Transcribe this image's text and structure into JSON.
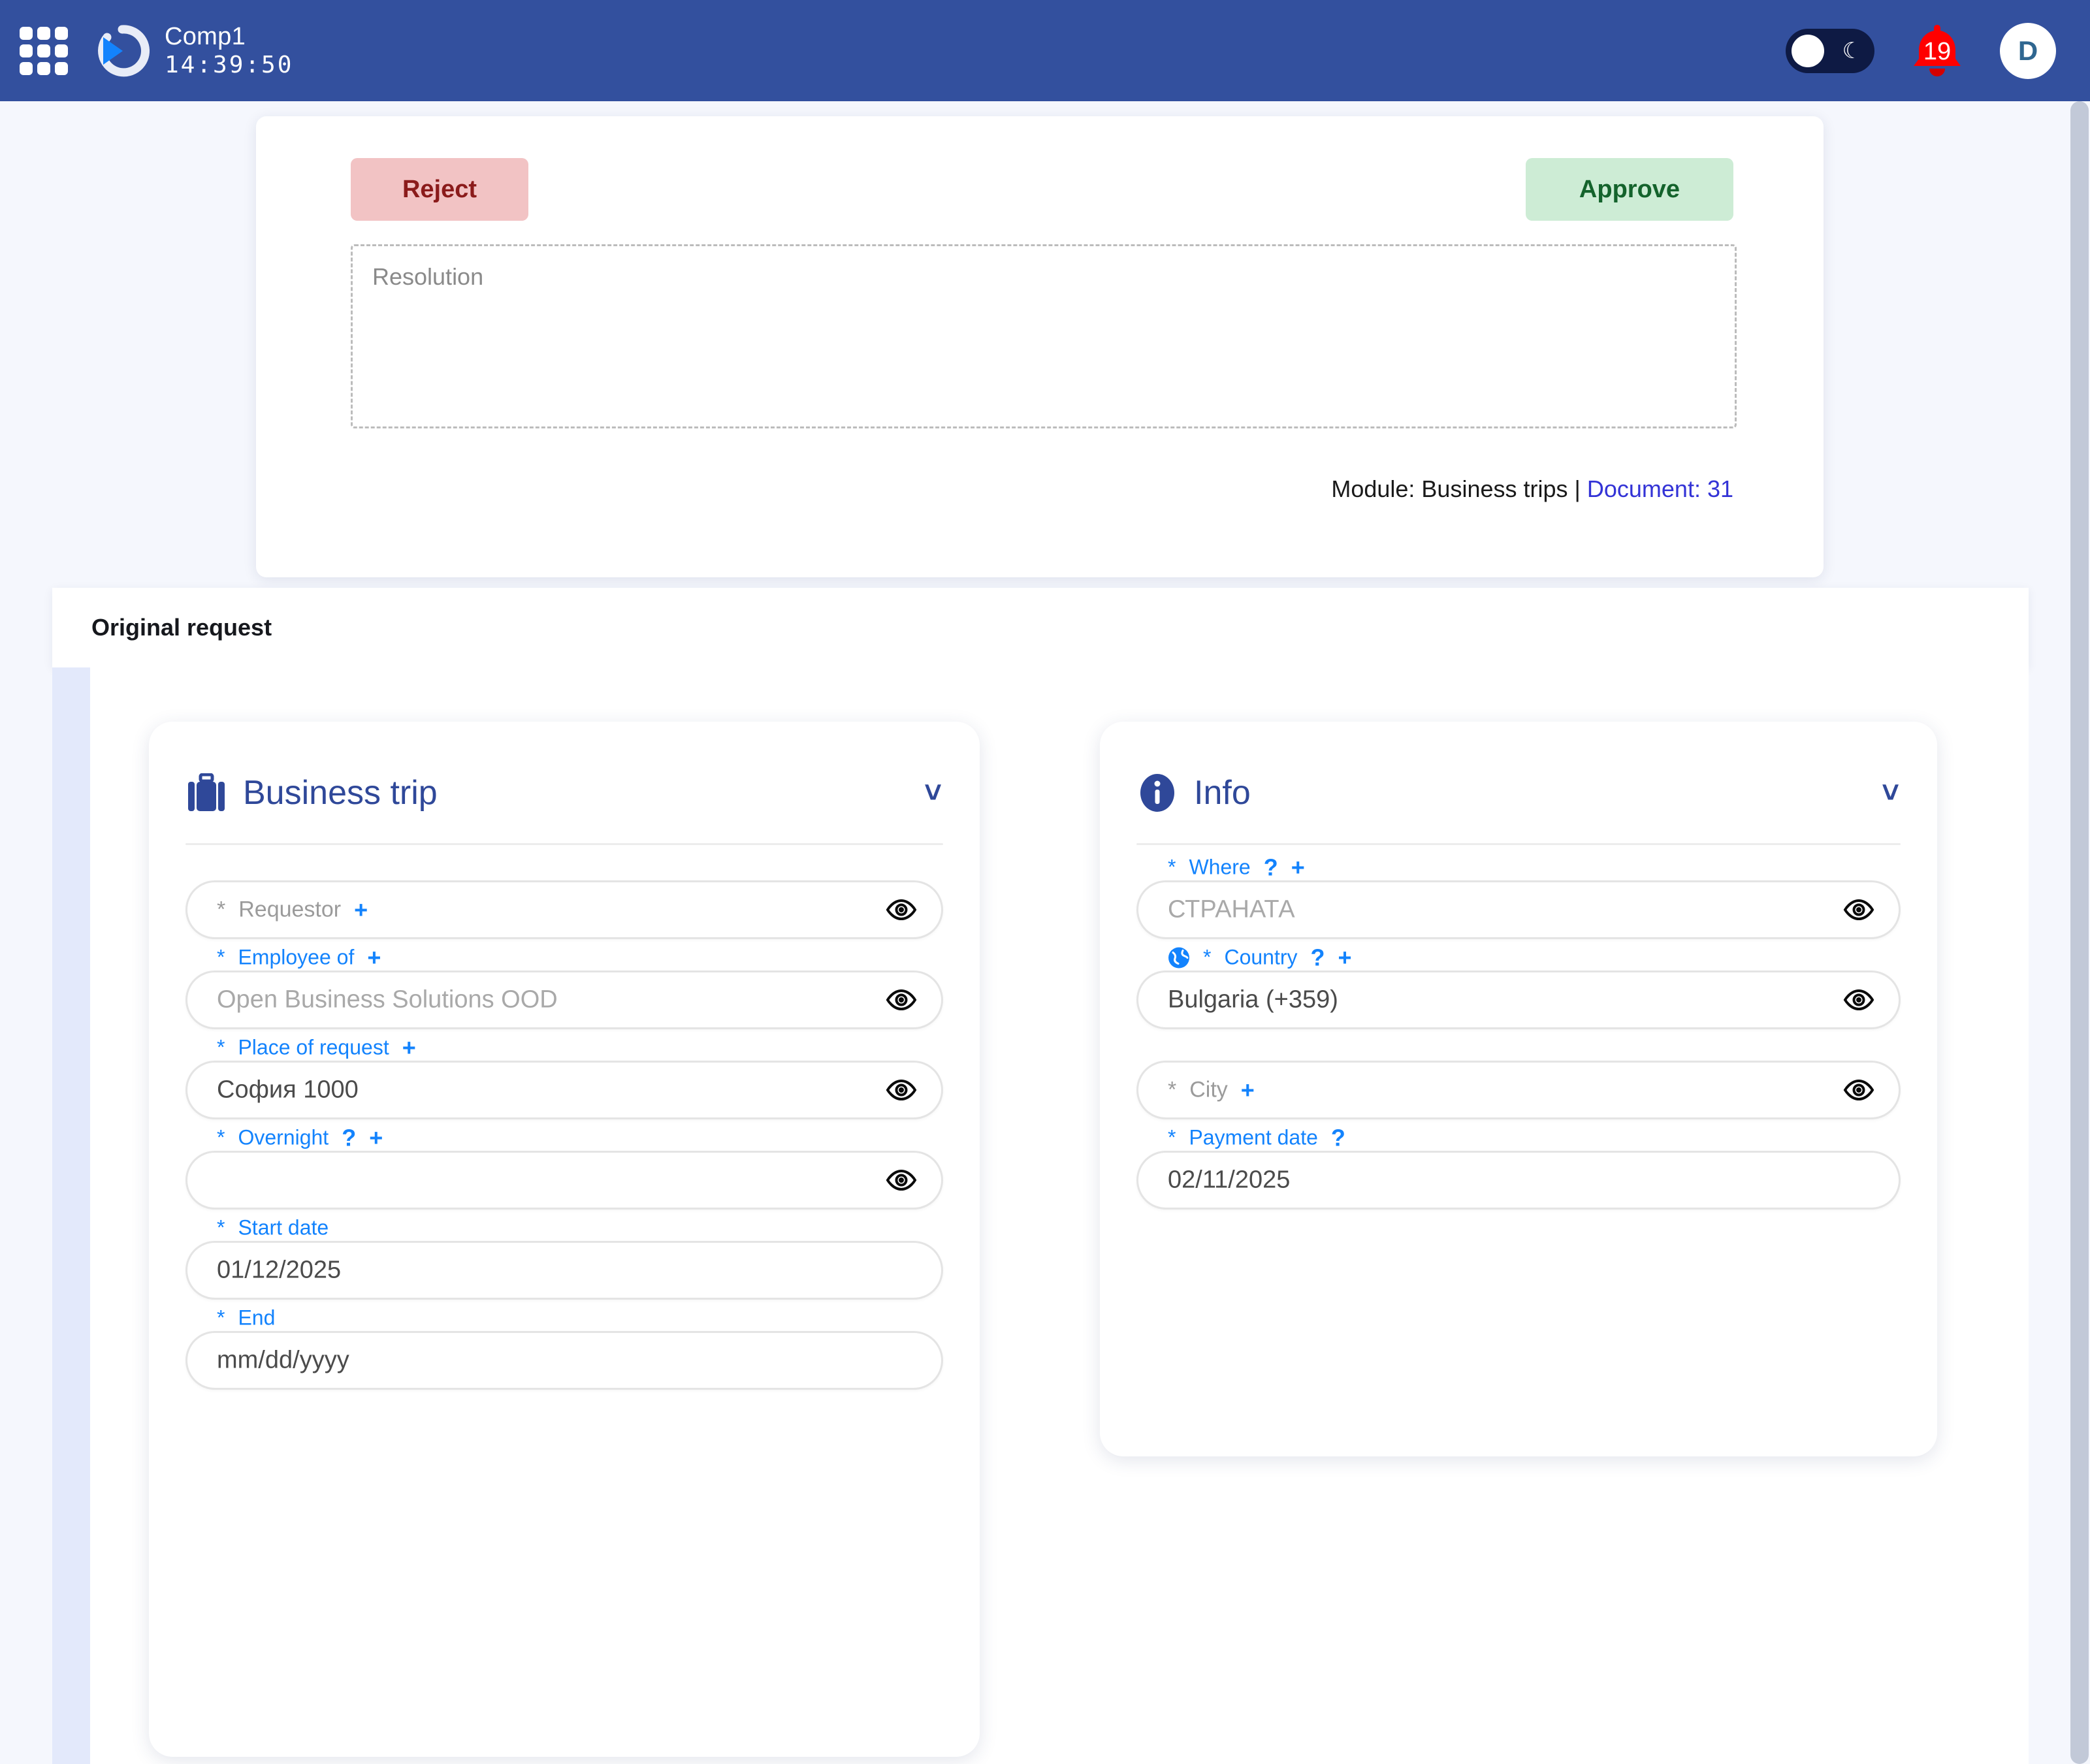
{
  "topbar": {
    "app_name": "Comp1",
    "clock": "14:39:50",
    "notification_count": "19",
    "avatar_initial": "D",
    "accent_bg": "#33509e",
    "bell_color": "#ff0000"
  },
  "resolution_card": {
    "reject_label": "Reject",
    "approve_label": "Approve",
    "resolution_placeholder": "Resolution",
    "resolution_value": "",
    "module_text": "Module: Business trips |",
    "document_link": "Document: 31"
  },
  "original_request": {
    "title": "Original request"
  },
  "cards": [
    {
      "id": "business-trip",
      "icon": "briefcase-icon",
      "title": "Business trip",
      "fields": [
        {
          "name": "requestor",
          "label": "Requestor",
          "required_star": "*",
          "label_state": "inline",
          "value": "",
          "has_plus": true,
          "has_help": false,
          "has_globe": false,
          "has_eye": true
        },
        {
          "name": "employee-of",
          "label": "Employee of",
          "required_star": "*",
          "label_state": "floating",
          "value": "Open Business Solutions OOD",
          "value_is_placeholder": true,
          "has_plus": true,
          "has_help": false,
          "has_globe": false,
          "has_eye": true
        },
        {
          "name": "place-of-request",
          "label": "Place of request",
          "required_star": "*",
          "label_state": "floating",
          "value": "София 1000",
          "value_is_placeholder": false,
          "has_plus": true,
          "has_help": false,
          "has_globe": false,
          "has_eye": true
        },
        {
          "name": "overnight",
          "label": "Overnight",
          "required_star": "*",
          "label_state": "floating",
          "value": "",
          "value_is_placeholder": false,
          "has_plus": true,
          "has_help": true,
          "has_globe": false,
          "has_eye": true
        },
        {
          "name": "start-date",
          "label": "Start date",
          "required_star": "*",
          "label_state": "floating",
          "value": "01/12/2025",
          "value_is_placeholder": false,
          "has_plus": false,
          "has_help": false,
          "has_globe": false,
          "has_eye": false
        },
        {
          "name": "end-date",
          "label": "End",
          "required_star": "*",
          "label_state": "floating",
          "value": "mm/dd/yyyy",
          "value_is_placeholder": false,
          "has_plus": false,
          "has_help": false,
          "has_globe": false,
          "has_eye": false
        }
      ]
    },
    {
      "id": "info",
      "icon": "info-circle-icon",
      "title": "Info",
      "fields": [
        {
          "name": "where",
          "label": "Where",
          "required_star": "*",
          "label_state": "floating",
          "value": "СТРАНАТА",
          "value_is_placeholder": true,
          "has_plus": true,
          "has_help": true,
          "has_globe": false,
          "has_eye": true
        },
        {
          "name": "country",
          "label": "Country",
          "required_star": "*",
          "label_state": "floating",
          "value": "Bulgaria (+359)",
          "value_is_placeholder": false,
          "has_plus": true,
          "has_help": true,
          "has_globe": true,
          "has_eye": true
        },
        {
          "name": "city",
          "label": "City",
          "required_star": "*",
          "label_state": "inline",
          "value": "",
          "has_plus": true,
          "has_help": false,
          "has_globe": false,
          "has_eye": true
        },
        {
          "name": "payment-date",
          "label": "Payment date",
          "required_star": "*",
          "label_state": "floating",
          "value": "02/11/2025",
          "value_is_placeholder": false,
          "has_plus": false,
          "has_help": true,
          "has_globe": false,
          "has_eye": false
        }
      ]
    }
  ]
}
